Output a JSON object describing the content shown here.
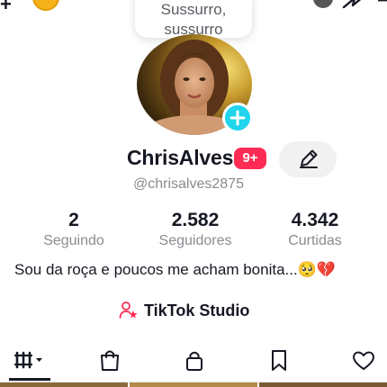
{
  "bubble": {
    "line1": "Sussurro,",
    "line2": "sussurro"
  },
  "profile": {
    "display_name": "ChrisAlves",
    "badge": "9+",
    "handle": "@chrisalves2875",
    "bio": "Sou da roça e poucos me acham bonita...🥺💔"
  },
  "stats": [
    {
      "value": "2",
      "label": "Seguindo"
    },
    {
      "value": "2.582",
      "label": "Seguidores"
    },
    {
      "value": "4.342",
      "label": "Curtidas"
    }
  ],
  "studio": {
    "label": "TikTok Studio"
  },
  "top_bar": {
    "plus_glyph": "+"
  },
  "tabs": [
    {
      "icon": "grid-filter-icon"
    },
    {
      "icon": "shopping-bag-icon"
    },
    {
      "icon": "lock-icon"
    },
    {
      "icon": "bookmark-icon"
    },
    {
      "icon": "heart-icon"
    }
  ],
  "colors": {
    "accent": "#fe2c55",
    "add_button": "#20d5ec",
    "muted_text": "#8a8b91"
  }
}
